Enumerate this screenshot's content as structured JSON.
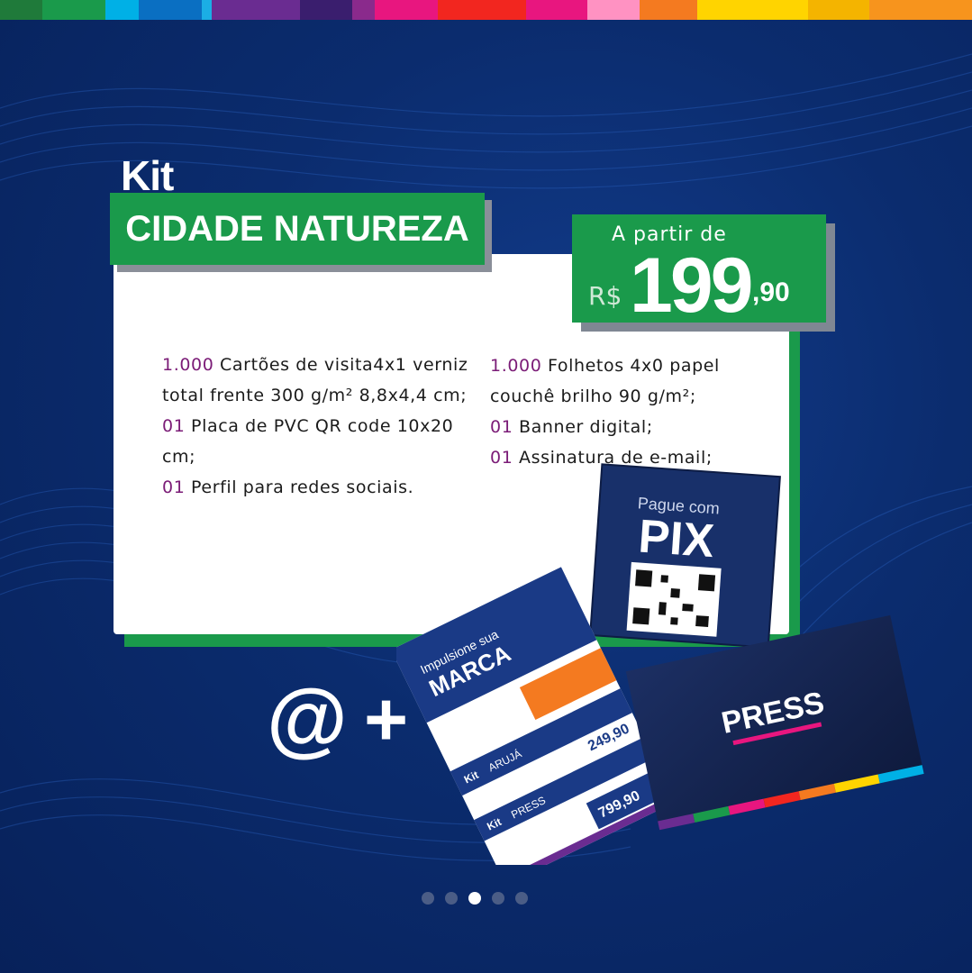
{
  "header": {
    "kit_label": "Kit",
    "title": "CIDADE NATUREZA"
  },
  "price": {
    "prefix": "A partir de",
    "currency": "R$",
    "integer": "199",
    "decimal": ",90"
  },
  "items_left": [
    {
      "qty": "1.000",
      "text": " Cartões de visita4x1 verniz total frente 300 g/m² 8,8x4,4 cm;"
    },
    {
      "qty": "01",
      "text": " Placa de PVC QR code 10x20 cm;"
    },
    {
      "qty": "01",
      "text": " Perfil para redes sociais."
    }
  ],
  "items_right": [
    {
      "qty": "1.000",
      "text": " Folhetos 4x0 papel couchê brilho 90 g/m²;"
    },
    {
      "qty": "01",
      "text": " Banner digital;"
    },
    {
      "qty": "01",
      "text": " Assinatura de e-mail;"
    }
  ],
  "bottom_icons": {
    "at": "@",
    "plus": "+"
  },
  "mockups": {
    "pix_header": "Pague com",
    "pix_title": "PIX",
    "flyer_title_1": "Impulsione sua",
    "flyer_title_2": "MARCA",
    "flyer_kit_1": "Kit",
    "flyer_kit_1_name": "ARUJÁ",
    "flyer_price_1": "249,90",
    "flyer_kit_2": "Kit",
    "flyer_kit_2_name": "PRESS",
    "flyer_price_2": "799,90",
    "card_brand": "PRESS"
  },
  "carousel": {
    "count": 5,
    "active_index": 2
  },
  "colors": {
    "brand_green": "#1a9a4b",
    "background_blue": "#0b2c6e",
    "number_purple": "#7b1c77",
    "stripe": [
      "#1f7a3a",
      "#00b0e6",
      "#0a6fc2",
      "#1baee5",
      "#6a2c91",
      "#3a1e6e",
      "#8a2a8c",
      "#e8167f",
      "#f2261f",
      "#ff3b30",
      "#e8167f",
      "#ff92c2",
      "#f47a20",
      "#ffd400",
      "#f4b400",
      "#f7941d"
    ]
  },
  "icons": [
    "at-icon",
    "plus-icon",
    "qr-code-icon"
  ]
}
